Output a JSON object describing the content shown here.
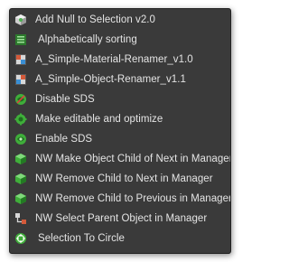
{
  "menu": {
    "items": [
      {
        "label": "Add Null to Selection v2.0",
        "icon": "null-cube-icon"
      },
      {
        "label": "Alphabetically sorting",
        "icon": "sort-list-icon"
      },
      {
        "label": "A_Simple-Material-Renamer_v1.0",
        "icon": "material-grid-icon"
      },
      {
        "label": "A_Simple-Object-Renamer_v1.1",
        "icon": "object-grid-icon"
      },
      {
        "label": "Disable SDS",
        "icon": "sds-disable-icon"
      },
      {
        "label": "Make editable and optimize",
        "icon": "gear-script-icon"
      },
      {
        "label": "Enable SDS",
        "icon": "sds-enable-icon"
      },
      {
        "label": "NW Make Object Child of Next in Manager",
        "icon": "green-cube-icon"
      },
      {
        "label": "NW Remove Child to Next in Manager",
        "icon": "green-cube-icon"
      },
      {
        "label": "NW Remove Child to Previous in Manager",
        "icon": "green-cube-icon"
      },
      {
        "label": "NW Select Parent Object in Manager",
        "icon": "hierarchy-icon"
      },
      {
        "label": "Selection To Circle",
        "icon": "circle-select-icon"
      }
    ]
  },
  "colors": {
    "menu_background": "#3a3a3a",
    "text": "#e4e4e4",
    "icon_green": "#3fae3a"
  }
}
